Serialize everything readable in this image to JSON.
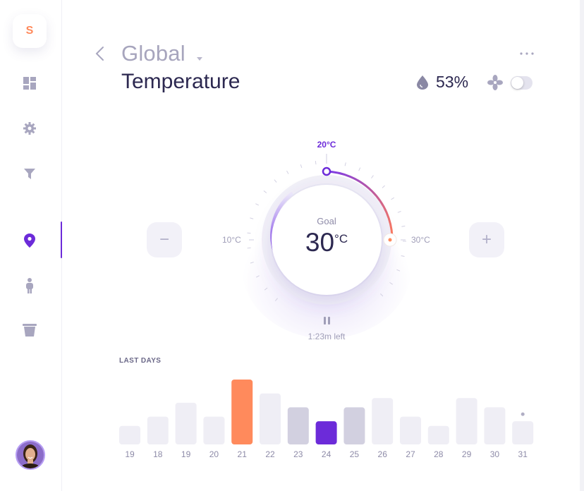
{
  "sidebar": {
    "logo": "S",
    "icons": [
      "dashboard-icon",
      "gear-icon",
      "filter-icon",
      "location-pin-icon",
      "person-icon",
      "trash-icon"
    ],
    "active": "location-pin-icon"
  },
  "header": {
    "location": "Global",
    "title": "Temperature",
    "humidity": "53%",
    "fan_toggle_on": false
  },
  "thermostat": {
    "goal_label": "Goal",
    "goal_value": "30",
    "goal_unit": "°C",
    "min_label": "10°C",
    "max_label": "30°C",
    "top_label": "20°C",
    "time_left": "1:23m left",
    "minus_label": "−",
    "plus_label": "+"
  },
  "colors": {
    "accent": "#6c2bd9",
    "orange": "#ff8a5c",
    "bar_light": "#efeef5",
    "bar_mid": "#d2d0e0"
  },
  "last_days": {
    "label": "LAST DAYS",
    "chart_data": {
      "type": "bar",
      "categories": [
        "19",
        "18",
        "19",
        "20",
        "21",
        "22",
        "23",
        "24",
        "25",
        "26",
        "27",
        "28",
        "29",
        "30",
        "31"
      ],
      "values": [
        2,
        3,
        4.5,
        3,
        7,
        5.5,
        4,
        2.5,
        4,
        5,
        3,
        2,
        5,
        4,
        2.5
      ],
      "highlight": {
        "4": "orange",
        "7": "accent",
        "6": "mid",
        "8": "mid"
      },
      "marker_on_index": 14
    }
  }
}
